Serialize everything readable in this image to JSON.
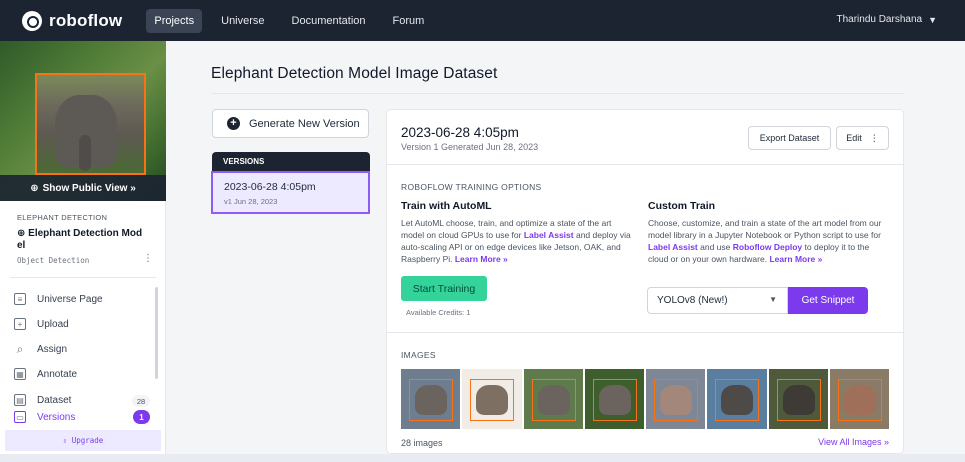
{
  "nav": {
    "brand": "roboflow",
    "items": [
      {
        "label": "Projects"
      },
      {
        "label": "Universe"
      },
      {
        "label": "Documentation"
      },
      {
        "label": "Forum"
      }
    ],
    "user": "Tharindu Darshana"
  },
  "sidebar": {
    "show_public": "Show Public View",
    "project_label": "ELEPHANT DETECTION",
    "project_name": "Elephant Detection Mod el",
    "project_type": "Object Detection",
    "items": [
      {
        "label": "Universe Page",
        "icon": "universe-page-icon"
      },
      {
        "label": "Upload",
        "icon": "upload-icon"
      },
      {
        "label": "Assign",
        "icon": "search-icon"
      },
      {
        "label": "Annotate",
        "icon": "annotate-icon"
      },
      {
        "label": "Dataset",
        "icon": "dataset-icon"
      },
      {
        "label": "Versions",
        "icon": "versions-icon"
      }
    ],
    "dataset_count": "28",
    "versions_count": "1",
    "upgrade": "Upgrade"
  },
  "main": {
    "title": "Elephant Detection Model Image Dataset",
    "generate_btn": "Generate New Version",
    "versions_header": "VERSIONS",
    "version_item": {
      "date": "2023-06-28 4:05pm",
      "sub": "v1 Jun 28, 2023"
    }
  },
  "card": {
    "version_title": "2023-06-28 4:05pm",
    "version_sub": "Version 1 Generated Jun 28, 2023",
    "export_btn": "Export Dataset",
    "edit_btn": "Edit",
    "options_label": "ROBOFLOW TRAINING OPTIONS",
    "automl": {
      "title": "Train with AutoML",
      "text1": "Let AutoML choose, train, and optimize a state of the art model on cloud GPUs to use for ",
      "link1": "Label Assist",
      "text2": " and deploy via auto-scaling API or on edge devices like Jetson, OAK, and Raspberry Pi. ",
      "learn": "Learn More »",
      "button": "Start Training",
      "credits": "Available Credits: 1"
    },
    "custom": {
      "title": "Custom Train",
      "text1": "Choose, customize, and train a state of the art model from our model library in a Jupyter Notebook or Python script to use for ",
      "link1": "Label Assist",
      "text2": " and use ",
      "link2": "Roboflow Deploy",
      "text3": " to deploy it to the cloud or on your own hardware. ",
      "learn": "Learn More »",
      "model": "YOLOv8 (New!)",
      "button": "Get Snippet"
    },
    "images_label": "IMAGES",
    "image_count": "28 images",
    "view_all": "View All Images »"
  },
  "colors": {
    "nav_bg": "#1c2432",
    "accent": "#7c3aed",
    "train": "#34d399"
  }
}
